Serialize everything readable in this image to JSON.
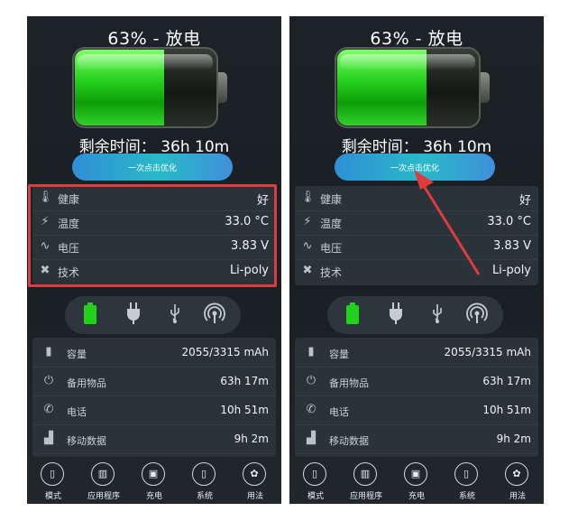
{
  "status_title": "63% - 放电",
  "battery_level": 0.63,
  "remaining": "剩余时间： 36h 10m",
  "optimize_label": "一次点击优化",
  "info_rows": [
    {
      "icon": "thermometer-icon",
      "label": "健康",
      "value": "好"
    },
    {
      "icon": "bolt-icon",
      "label": "温度",
      "value": "33.0 °C"
    },
    {
      "icon": "pulse-icon",
      "label": "电压",
      "value": "3.83 V"
    },
    {
      "icon": "tools-icon",
      "label": "技术",
      "value": "Li-poly"
    }
  ],
  "mode_icons": [
    "battery-icon",
    "plug-icon",
    "usb-icon",
    "wireless-icon"
  ],
  "stats_rows": [
    {
      "icon": "battery-small-icon",
      "label": "容量",
      "value": "2055/3315 mAh"
    },
    {
      "icon": "power-icon",
      "label": "备用物品",
      "value": "63h 17m"
    },
    {
      "icon": "phone-icon",
      "label": "电话",
      "value": "10h 51m"
    },
    {
      "icon": "signal-icon",
      "label": "移动数据",
      "value": "9h 2m"
    }
  ],
  "nav_items": [
    {
      "icon": "mode-icon",
      "label": "模式"
    },
    {
      "icon": "apps-icon",
      "label": "应用程序"
    },
    {
      "icon": "charge-icon",
      "label": "充电"
    },
    {
      "icon": "system-icon",
      "label": "系统"
    },
    {
      "icon": "usage-icon",
      "label": "用法"
    }
  ],
  "colors": {
    "highlight": "#e23b3b",
    "accent_green": "#27d11e",
    "button": "#29b9c9"
  }
}
